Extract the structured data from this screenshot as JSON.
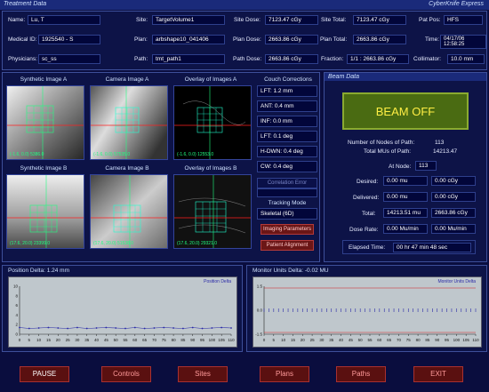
{
  "title_bar": {
    "left": "Treatment Data",
    "right": "CyberKnife Express"
  },
  "patient": {
    "name_label": "Name:",
    "name": "Lu, T",
    "medical_id_label": "Medical ID:",
    "medical_id": "1925540 - S",
    "physicians_label": "Physicians:",
    "physicians": "sc_ss",
    "site_label": "Site:",
    "site": "TargetVolume1",
    "plan_label": "Plan:",
    "plan": "arbshape10_041406",
    "path_label": "Path:",
    "path": "tmt_path1",
    "site_dose_label": "Site Dose:",
    "site_dose": "7123.47 cGy",
    "plan_dose_label": "Plan Dose:",
    "plan_dose": "2663.86 cGy",
    "path_dose_label": "Path Dose:",
    "path_dose": "2663.86 cGy",
    "site_total_label": "Site Total:",
    "site_total": "7123.47 cGy",
    "plan_total_label": "Plan Total:",
    "plan_total": "2663.86 cGy",
    "fraction_label": "Fraction:",
    "fraction": "1/1 : 2663.86 cGy",
    "pat_pos_label": "Pat Pos:",
    "pat_pos": "HFS",
    "time_label": "Time:",
    "time": "04/17/06 12:58:25",
    "collimator_label": "Collimator:",
    "collimator": "10.0 mm"
  },
  "images": {
    "synthetic_a": {
      "title": "Synthetic Image A",
      "caption": "(-1.6, 0.0) 5386.0"
    },
    "camera_a": {
      "title": "Camera Image A",
      "caption": "(-1.6, 0.0) 57535.0"
    },
    "overlay_a": {
      "title": "Overlay of Images A",
      "caption": "(-1.6, 0.0) 12553.0"
    },
    "synthetic_b": {
      "title": "Synthetic Image B",
      "caption": "(17.6, 20.0) 23399.0"
    },
    "camera_b": {
      "title": "Camera Image B",
      "caption": "(17.6, 20.0) 51538.0"
    },
    "overlay_b": {
      "title": "Overlay of Images B",
      "caption": "(17.6, 20.0) 29321.0"
    }
  },
  "couch": {
    "title": "Couch Corrections",
    "lft": "LFT: 1.2 mm",
    "ant": "ANT: 0.4 mm",
    "inf": "INF: 0.0 mm",
    "lft_deg": "LFT: 0.1 deg",
    "hdwn": "H-DWN: 0.4 deg",
    "cw": "CW: 0.4 deg",
    "correlation_error": "Correlation Error",
    "tracking_mode_label": "Tracking Mode",
    "tracking_mode": "Skeletal (6D)",
    "imaging_params_btn": "Imaging Parameters",
    "patient_alignment_btn": "Patient Alignment"
  },
  "beam": {
    "panel_title": "Beam Data",
    "status": "BEAM OFF",
    "nodes_label": "Number of Nodes of Path:",
    "nodes": "113",
    "total_mus_label": "Total MUs of Path:",
    "total_mus": "14213.47",
    "at_node_label": "At Node:",
    "at_node": "113",
    "desired_label": "Desired:",
    "desired_mu": "0.00 mu",
    "desired_cgy": "0.00 cGy",
    "delivered_label": "Delivered:",
    "delivered_mu": "0.00 mu",
    "delivered_cgy": "0.00 cGy",
    "total_label": "Total:",
    "total_mu": "14213.51 mu",
    "total_cgy": "2663.86 cGy",
    "dose_rate_label": "Dose Rate:",
    "dose_rate_1": "0.00 Mu/min",
    "dose_rate_2": "0.00 Mu/min",
    "elapsed_label": "Elapsed Time:",
    "elapsed": "00 hr  47 min  48 sec"
  },
  "position_delta": {
    "title": "Position Delta: 1.24 mm",
    "legend": "Position Delta",
    "y_ticks": [
      "10",
      "8",
      "6",
      "4",
      "2",
      "0"
    ],
    "x_ticks": [
      "0",
      "5",
      "10",
      "15",
      "20",
      "25",
      "30",
      "35",
      "40",
      "45",
      "50",
      "55",
      "60",
      "65",
      "70",
      "75",
      "80",
      "85",
      "90",
      "95",
      "100",
      "105",
      "110"
    ]
  },
  "monitor_units": {
    "title": "Monitor Units Delta: -0.02 MU",
    "legend": "Monitor Units Delta",
    "y_ticks": [
      "1.5",
      "0.0",
      "-1.5"
    ],
    "x_ticks": [
      "0",
      "5",
      "10",
      "15",
      "20",
      "25",
      "30",
      "35",
      "40",
      "45",
      "50",
      "55",
      "60",
      "65",
      "70",
      "75",
      "80",
      "85",
      "90",
      "95",
      "100",
      "105",
      "110"
    ]
  },
  "bottom_buttons": {
    "pause": "PAUSE",
    "controls": "Controls",
    "sites": "Sites",
    "plans": "Plans",
    "paths": "Paths",
    "exit": "EXIT"
  },
  "colors": {
    "bg": "#0a0d3e",
    "accent": "#1a2a7a",
    "beam_off_bg": "#4a6b12",
    "beam_off_text": "#ffee44",
    "crosshair": "#ff2020",
    "grid": "#20ff80"
  },
  "icons": {
    "beam_status": "beam-status-indicator"
  }
}
